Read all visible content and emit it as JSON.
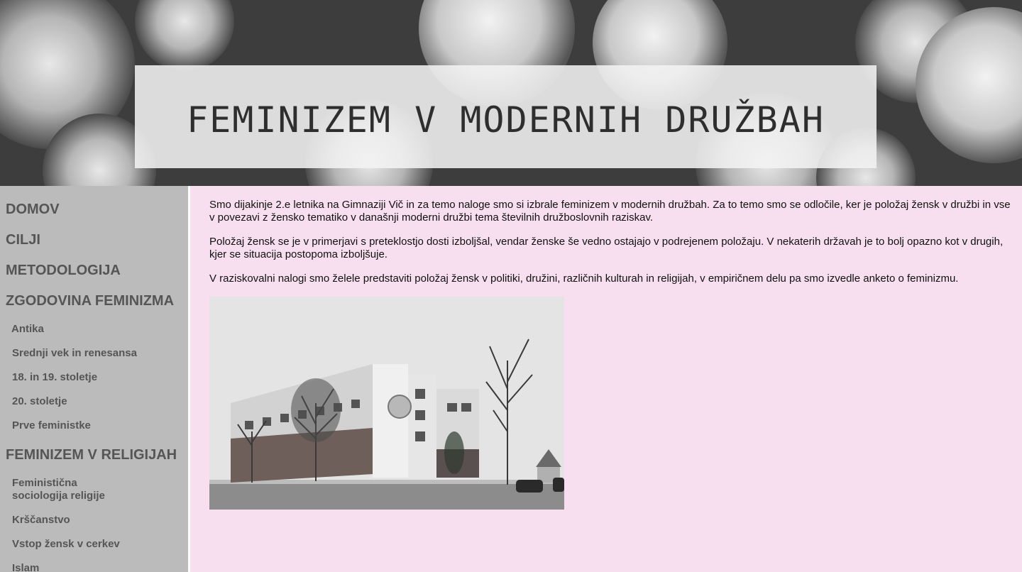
{
  "banner": {
    "title": "FEMINIZEM V MODERNIH DRUŽBAH"
  },
  "sidebar": {
    "domov": "DOMOV",
    "cilji": "CILJI",
    "metodologija": "METODOLOGIJA",
    "zgodovina": {
      "label": "ZGODOVINA FEMINIZMA",
      "items": [
        "Antika",
        "Srednji vek in renesansa",
        "18. in 19. stoletje",
        "20. stoletje",
        "Prve feministke"
      ]
    },
    "religije": {
      "label": "FEMINIZEM V RELIGIJAH",
      "items": [
        "Feministična sociologija religije",
        "Krščanstvo",
        "Vstop žensk v cerkev",
        "Islam"
      ]
    }
  },
  "content": {
    "paragraphs": [
      "Smo dijakinje 2.e letnika na Gimnaziji Vič in za temo naloge smo si izbrale feminizem v modernih družbah. Za to temo smo se odločile, ker je položaj žensk v družbi in vse v povezavi z žensko tematiko v današnji  moderni družbi tema številnih družboslovnih raziskav.",
      "Položaj žensk se je v primerjavi s preteklostjo dosti izboljšal, vendar ženske še vedno ostajajo v podrejenem položaju. V nekaterih državah je to bolj opazno kot v drugih, kjer se situacija postopoma izboljšuje.",
      "V raziskovalni nalogi smo želele predstaviti položaj žensk v politiki, družini, različnih kulturah in religijah, v empiričnem delu pa smo izvedle anketo o feminizmu."
    ]
  },
  "colors": {
    "page_bg": "#f7dff0",
    "sidebar_bg": "#bbbbbb",
    "nav_text": "#555555"
  }
}
